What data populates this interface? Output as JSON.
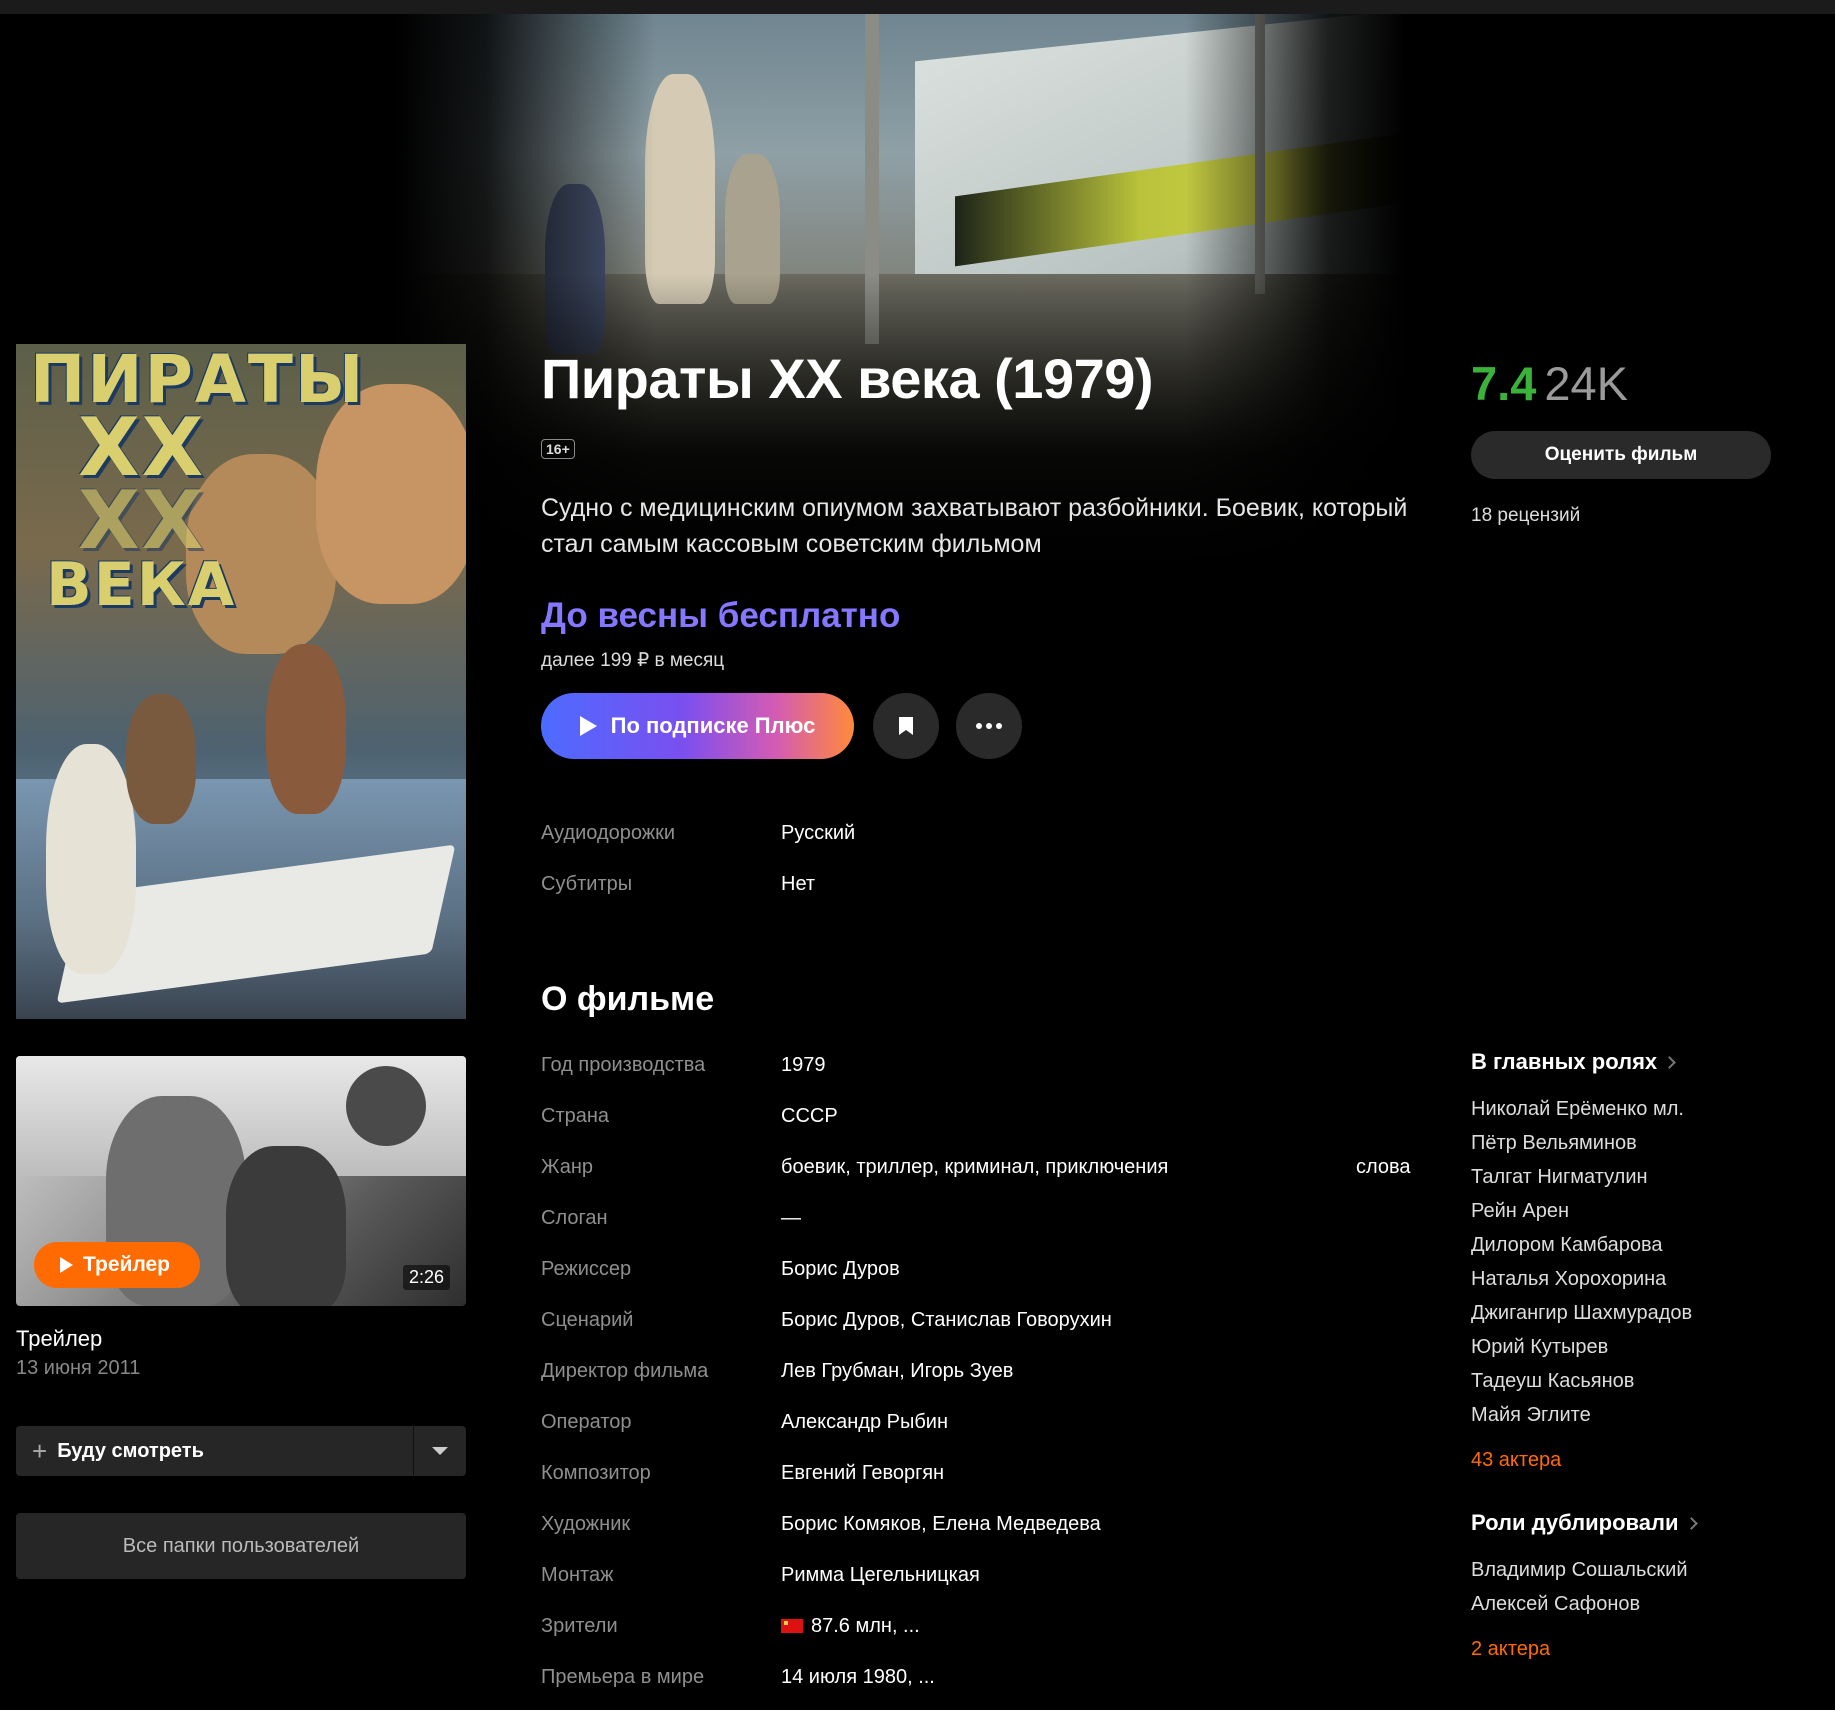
{
  "film": {
    "title": "Пираты XX века (1979)",
    "age_rating": "16+",
    "synopsis": "Судно с медицинским опиумом захватывают разбойники. Боевик, который стал самым кассовым советским фильмом"
  },
  "poster": {
    "title_lines": [
      "ПИРАТЫ",
      "XX",
      "XX",
      "ВЕКА"
    ]
  },
  "offer": {
    "headline": "До весны бесплатно",
    "subline": "далее 199 ₽ в месяц",
    "play_label": "По подписке Плюс"
  },
  "tracks": [
    {
      "key": "Аудиодорожки",
      "value": "Русский"
    },
    {
      "key": "Субтитры",
      "value": "Нет"
    }
  ],
  "about": {
    "heading": "О фильме",
    "rows": [
      {
        "key": "Год производства",
        "value": "1979"
      },
      {
        "key": "Страна",
        "value": "СССР"
      },
      {
        "key": "Жанр",
        "value": "боевик, триллер, криминал, приключения"
      },
      {
        "key": "Слоган",
        "value": "—"
      },
      {
        "key": "Режиссер",
        "value": "Борис Дуров"
      },
      {
        "key": "Сценарий",
        "value": "Борис Дуров, Станислав Говорухин"
      },
      {
        "key": "Директор фильма",
        "value": "Лев Грубман, Игорь Зуев"
      },
      {
        "key": "Оператор",
        "value": "Александр Рыбин"
      },
      {
        "key": "Композитор",
        "value": "Евгений Геворгян"
      },
      {
        "key": "Художник",
        "value": "Борис Комяков, Елена Медведева"
      },
      {
        "key": "Монтаж",
        "value": "Римма Цегельницкая"
      },
      {
        "key": "Зрители",
        "value": "87.6 млн, ..."
      },
      {
        "key": "Премьера в мире",
        "value": "14 июля 1980, ..."
      }
    ],
    "genre_extra": "слова"
  },
  "rating": {
    "score": "7.4",
    "votes": "24K",
    "score_color": "#3bb33b",
    "rate_label": "Оценить фильм",
    "reviews": "18 рецензий"
  },
  "cast": {
    "heading": "В главных ролях",
    "names": [
      "Николай Ерёменко мл.",
      "Пётр Вельяминов",
      "Талгат Нигматулин",
      "Рейн Арен",
      "Дилором Камбарова",
      "Наталья Хорохорина",
      "Джигангир Шахмурадов",
      "Юрий Кутырев",
      "Тадеуш Касьянов",
      "Майя Эглите"
    ],
    "more": "43 актера"
  },
  "dubbing": {
    "heading": "Роли дублировали",
    "names": [
      "Владимир Сошальский",
      "Алексей Сафонов"
    ],
    "more": "2 актера"
  },
  "trailer": {
    "button": "Трейлер",
    "duration": "2:26",
    "title": "Трейлер",
    "date": "13 июня 2011"
  },
  "actions": {
    "watchlist": "Буду смотреть",
    "folders": "Все папки пользователей"
  },
  "colors": {
    "accent_orange": "#ff6b00",
    "promo_purple": "#8577ff"
  }
}
